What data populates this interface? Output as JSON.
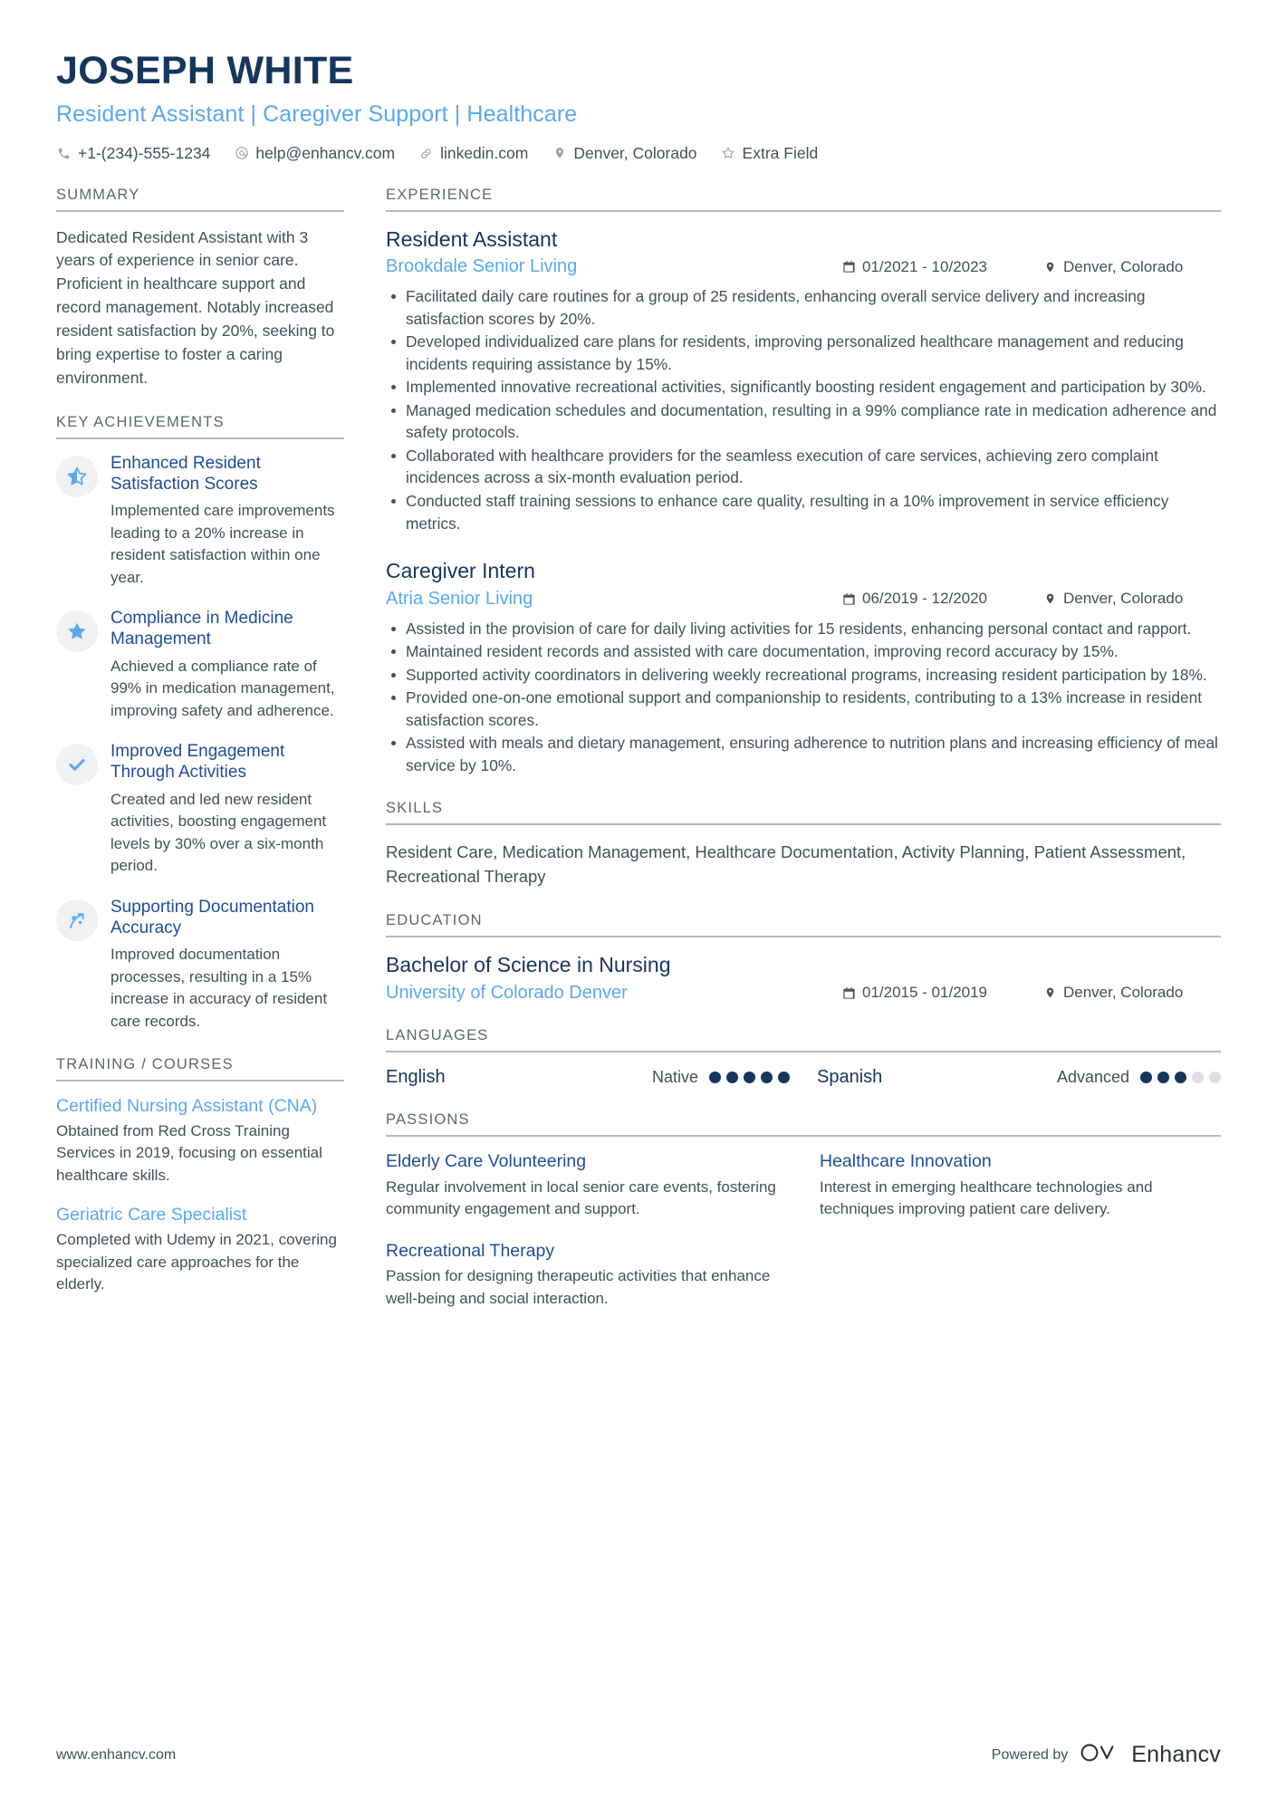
{
  "header": {
    "name": "JOSEPH WHITE",
    "headline": "Resident Assistant | Caregiver Support | Healthcare",
    "contacts": [
      {
        "icon": "phone-icon",
        "text": "+1-(234)-555-1234"
      },
      {
        "icon": "email-icon",
        "text": "help@enhancv.com"
      },
      {
        "icon": "link-icon",
        "text": "linkedin.com"
      },
      {
        "icon": "location-pin-icon",
        "text": "Denver, Colorado"
      },
      {
        "icon": "star-outline-icon",
        "text": "Extra Field"
      }
    ]
  },
  "summary": {
    "title": "SUMMARY",
    "text": "Dedicated Resident Assistant with 3 years of experience in senior care. Proficient in healthcare support and record management. Notably increased resident satisfaction by 20%, seeking to bring expertise to foster a caring environment."
  },
  "achievements": {
    "title": "KEY ACHIEVEMENTS",
    "items": [
      {
        "icon": "half-star-icon",
        "title": "Enhanced Resident Satisfaction Scores",
        "desc": "Implemented care improvements leading to a 20% increase in resident satisfaction within one year."
      },
      {
        "icon": "star-filled-icon",
        "title": "Compliance in Medicine Management",
        "desc": "Achieved a compliance rate of 99% in medication management, improving safety and adherence."
      },
      {
        "icon": "check-icon",
        "title": "Improved Engagement Through Activities",
        "desc": "Created and led new resident activities, boosting engagement levels by 30% over a six-month period."
      },
      {
        "icon": "trending-arrow-icon",
        "title": "Supporting Documentation Accuracy",
        "desc": "Improved documentation processes, resulting in a 15% increase in accuracy of resident care records."
      }
    ]
  },
  "training": {
    "title": "TRAINING / COURSES",
    "items": [
      {
        "title": "Certified Nursing Assistant (CNA)",
        "desc": "Obtained from Red Cross Training Services in 2019, focusing on essential healthcare skills."
      },
      {
        "title": "Geriatric Care Specialist",
        "desc": "Completed with Udemy in 2021, covering specialized care approaches for the elderly."
      }
    ]
  },
  "experience": {
    "title": "EXPERIENCE",
    "jobs": [
      {
        "role": "Resident Assistant",
        "company": "Brookdale Senior Living",
        "dates": "01/2021 - 10/2023",
        "location": "Denver, Colorado",
        "bullets": [
          "Facilitated daily care routines for a group of 25 residents, enhancing overall service delivery and increasing satisfaction scores by 20%.",
          "Developed individualized care plans for residents, improving personalized healthcare management and reducing incidents requiring assistance by 15%.",
          "Implemented innovative recreational activities, significantly boosting resident engagement and participation by 30%.",
          "Managed medication schedules and documentation, resulting in a 99% compliance rate in medication adherence and safety protocols.",
          "Collaborated with healthcare providers for the seamless execution of care services, achieving zero complaint incidences across a six-month evaluation period.",
          "Conducted staff training sessions to enhance care quality, resulting in a 10% improvement in service efficiency metrics."
        ]
      },
      {
        "role": "Caregiver Intern",
        "company": "Atria Senior Living",
        "dates": "06/2019 - 12/2020",
        "location": "Denver, Colorado",
        "bullets": [
          "Assisted in the provision of care for daily living activities for 15 residents, enhancing personal contact and rapport.",
          "Maintained resident records and assisted with care documentation, improving record accuracy by 15%.",
          "Supported activity coordinators in delivering weekly recreational programs, increasing resident participation by 18%.",
          "Provided one-on-one emotional support and companionship to residents, contributing to a 13% increase in resident satisfaction scores.",
          "Assisted with meals and dietary management, ensuring adherence to nutrition plans and increasing efficiency of meal service by 10%."
        ]
      }
    ]
  },
  "skills": {
    "title": "SKILLS",
    "text": "Resident Care, Medication Management, Healthcare Documentation, Activity Planning, Patient Assessment, Recreational Therapy"
  },
  "education": {
    "title": "EDUCATION",
    "degree": "Bachelor of Science in Nursing",
    "school": "University of Colorado Denver",
    "dates": "01/2015 - 01/2019",
    "location": "Denver, Colorado"
  },
  "languages": {
    "title": "LANGUAGES",
    "items": [
      {
        "name": "English",
        "level": "Native",
        "filled": 5,
        "total": 5
      },
      {
        "name": "Spanish",
        "level": "Advanced",
        "filled": 3,
        "total": 5
      }
    ]
  },
  "passions": {
    "title": "PASSIONS",
    "items": [
      {
        "title": "Elderly Care Volunteering",
        "desc": "Regular involvement in local senior care events, fostering community engagement and support."
      },
      {
        "title": "Healthcare Innovation",
        "desc": "Interest in emerging healthcare technologies and techniques improving patient care delivery."
      },
      {
        "title": "Recreational Therapy",
        "desc": "Passion for designing therapeutic activities that enhance well-being and social interaction."
      }
    ]
  },
  "footer": {
    "url": "www.enhancv.com",
    "powered_by": "Powered by",
    "brand": "Enhancv"
  },
  "colors": {
    "navy": "#17365d",
    "light_blue": "#5ba8ef",
    "accent_blue": "#1f4e96",
    "body_text": "#45505a",
    "rule": "#b4b8bc"
  }
}
